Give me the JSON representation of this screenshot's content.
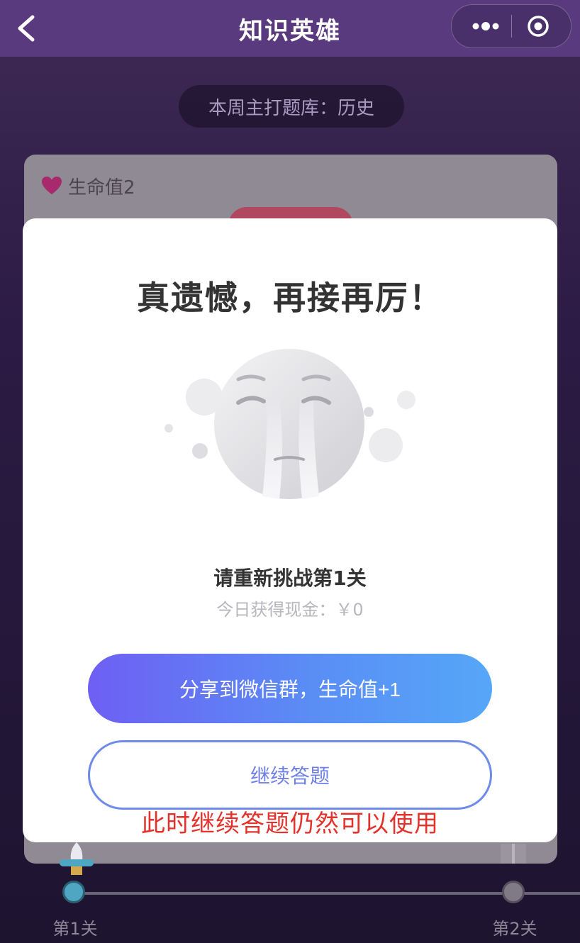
{
  "header": {
    "title": "知识英雄",
    "icons": {
      "back": "chevron-left-icon",
      "more": "more-dots-icon",
      "close": "target-circle-icon"
    }
  },
  "week_bank": "本周主打题库：历史",
  "life": {
    "label": "生命值2",
    "icon": "heart-icon",
    "heart_color": "#c0307d"
  },
  "modal": {
    "title": "真遗憾，再接再厉！",
    "illustration": "crying-face-icon",
    "retry_text": "请重新挑战第1关",
    "cash_text": "今日获得现金：￥0",
    "share_button": "分享到微信群，生命值+1",
    "continue_button": "继续答题"
  },
  "annotation": "此时继续答题仍然可以使用",
  "progress": {
    "levels": [
      "第1关",
      "第2关"
    ],
    "current_icon": "rocket-icon",
    "next_icon": "gift-icon"
  },
  "colors": {
    "header_bg": "#5a3a7e",
    "share_gradient_start": "#6e5ff4",
    "share_gradient_end": "#55a7f8",
    "continue_border": "#6e8be9",
    "annotation": "#e4312b"
  }
}
